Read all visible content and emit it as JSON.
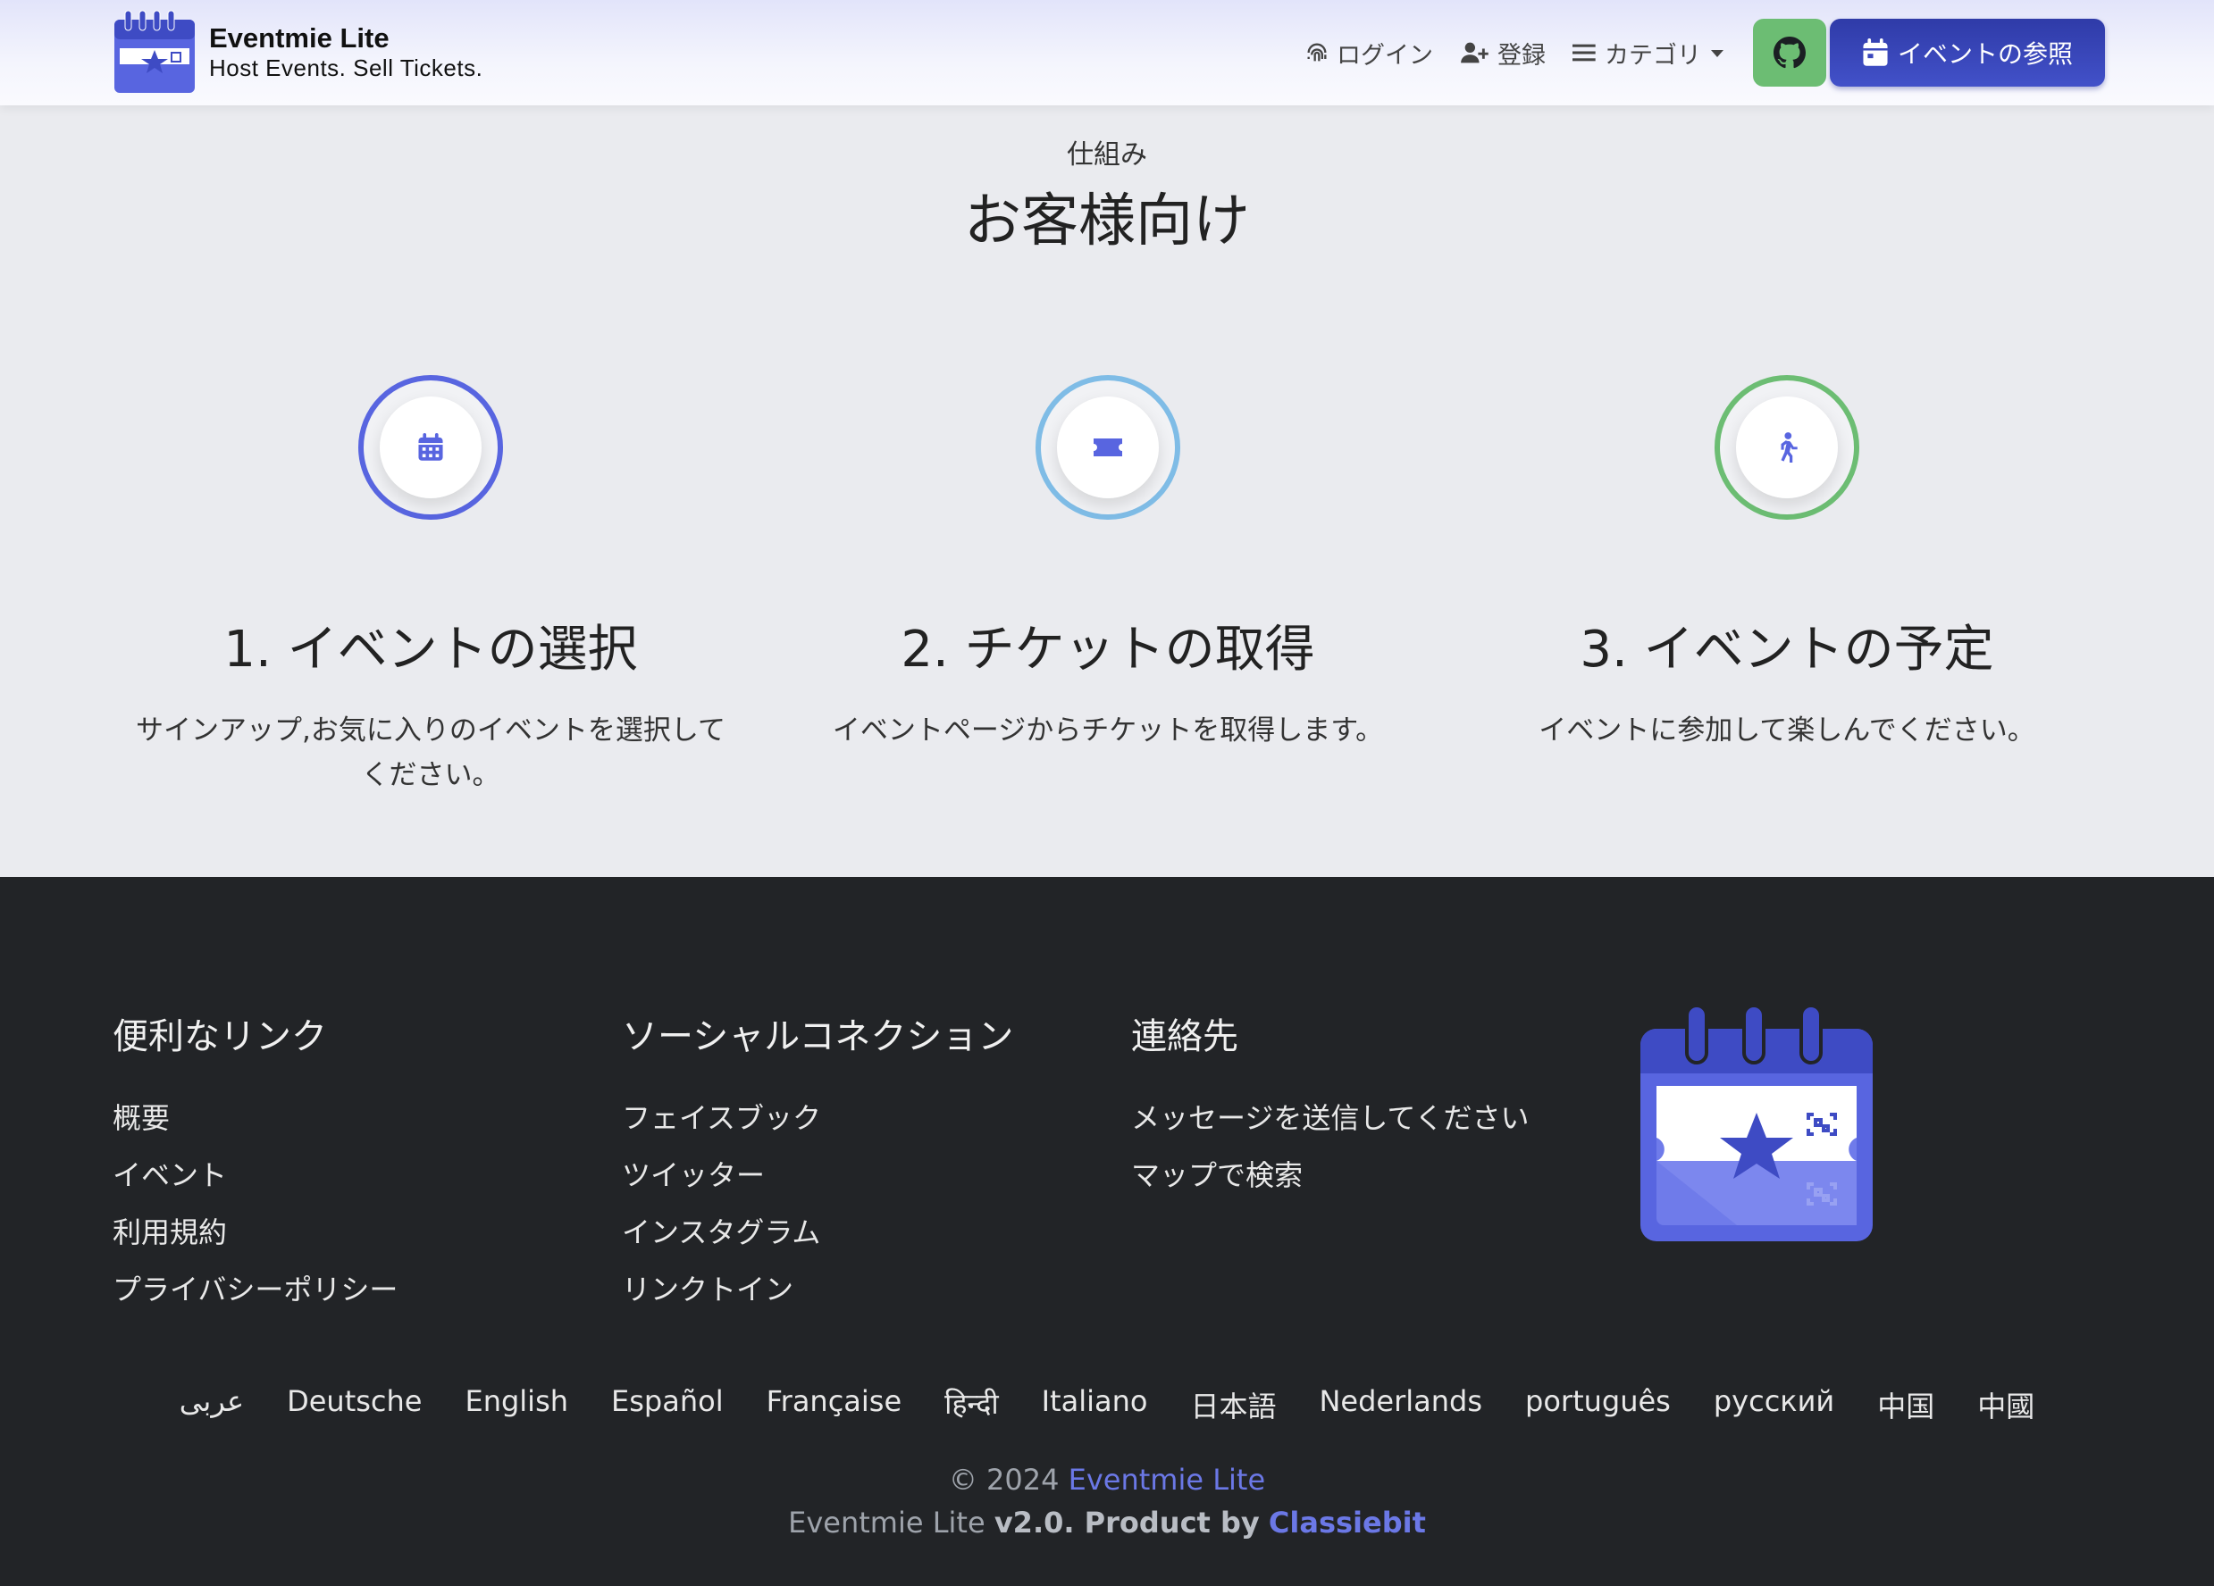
{
  "header": {
    "brand_title": "Eventmie Lite",
    "brand_tagline": "Host Events. Sell Tickets.",
    "nav": {
      "login": "ログイン",
      "register": "登録",
      "categories": "カテゴリ",
      "browse_events": "イベントの参照"
    }
  },
  "how_it_works": {
    "subtitle": "仕組み",
    "title": "お客様向け",
    "steps": [
      {
        "title": "1. イベントの選択",
        "desc": "サインアップ,お気に入りのイベントを選択してください。",
        "icon": "calendar-icon",
        "color": "#5865e0"
      },
      {
        "title": "2. チケットの取得",
        "desc": "イベントページからチケットを取得します。",
        "icon": "ticket-icon",
        "color": "#7fbce6"
      },
      {
        "title": "3. イベントの予定",
        "desc": "イベントに参加して楽しんでください。",
        "icon": "walking-icon",
        "color": "#6cbd73"
      }
    ]
  },
  "footer": {
    "useful_links": {
      "heading": "便利なリンク",
      "items": [
        "概要",
        "イベント",
        "利用規約",
        "プライバシーポリシー"
      ]
    },
    "social": {
      "heading": "ソーシャルコネクション",
      "items": [
        "フェイスブック",
        "ツイッター",
        "インスタグラム",
        "リンクトイン"
      ]
    },
    "contact": {
      "heading": "連絡先",
      "items": [
        "メッセージを送信してください",
        "マップで検索"
      ]
    },
    "languages": [
      "عربى",
      "Deutsche",
      "English",
      "Español",
      "Française",
      "हिन्दी",
      "Italiano",
      "日本語",
      "Nederlands",
      "português",
      "русский",
      "中国",
      "中國"
    ],
    "copyright_prefix": "© 2024",
    "copyright_brand": "Eventmie Lite",
    "version_prefix": "Eventmie Lite",
    "version_bold": "v2.0. Product by",
    "version_company": "Classiebit"
  },
  "colors": {
    "accent": "#5865e0",
    "footer_bg": "#222427",
    "github": "#6cbd73"
  }
}
